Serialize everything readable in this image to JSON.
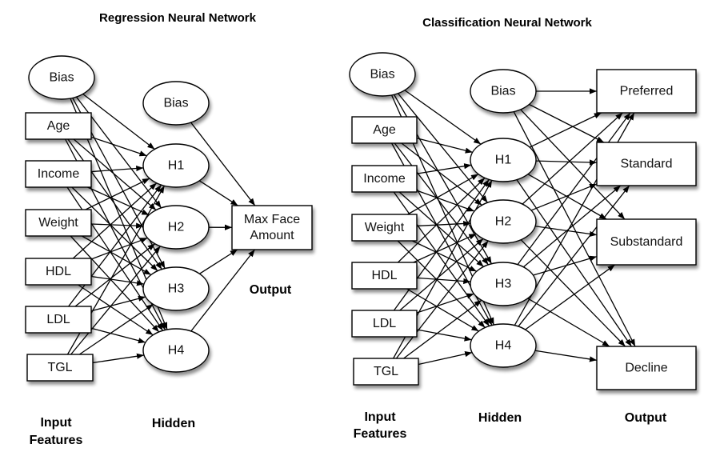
{
  "diagrams": [
    {
      "id": "regression",
      "title": "Regression Neural Network",
      "layer_labels": {
        "input": [
          "Input",
          "Features"
        ],
        "hidden": "Hidden",
        "output": "Output"
      },
      "input_nodes": [
        {
          "id": "bias_in",
          "label": "Bias",
          "shape": "ellipse"
        },
        {
          "id": "age",
          "label": "Age",
          "shape": "rect"
        },
        {
          "id": "income",
          "label": "Income",
          "shape": "rect"
        },
        {
          "id": "weight",
          "label": "Weight",
          "shape": "rect"
        },
        {
          "id": "hdl",
          "label": "HDL",
          "shape": "rect"
        },
        {
          "id": "ldl",
          "label": "LDL",
          "shape": "rect"
        },
        {
          "id": "tgl",
          "label": "TGL",
          "shape": "rect"
        }
      ],
      "hidden_nodes": [
        {
          "id": "bias_h",
          "label": "Bias",
          "shape": "ellipse"
        },
        {
          "id": "h1",
          "label": "H1",
          "shape": "ellipse"
        },
        {
          "id": "h2",
          "label": "H2",
          "shape": "ellipse"
        },
        {
          "id": "h3",
          "label": "H3",
          "shape": "ellipse"
        },
        {
          "id": "h4",
          "label": "H4",
          "shape": "ellipse"
        }
      ],
      "output_nodes": [
        {
          "id": "max_face",
          "label": [
            "Max Face",
            "Amount"
          ],
          "shape": "rect"
        }
      ],
      "connectivity": "fully connected: every input node to H1-H4; every hidden node (incl. Bias) to every output"
    },
    {
      "id": "classification",
      "title": "Classification Neural Network",
      "layer_labels": {
        "input": [
          "Input",
          "Features"
        ],
        "hidden": "Hidden",
        "output": "Output"
      },
      "input_nodes": [
        {
          "id": "bias_in",
          "label": "Bias",
          "shape": "ellipse"
        },
        {
          "id": "age",
          "label": "Age",
          "shape": "rect"
        },
        {
          "id": "income",
          "label": "Income",
          "shape": "rect"
        },
        {
          "id": "weight",
          "label": "Weight",
          "shape": "rect"
        },
        {
          "id": "hdl",
          "label": "HDL",
          "shape": "rect"
        },
        {
          "id": "ldl",
          "label": "LDL",
          "shape": "rect"
        },
        {
          "id": "tgl",
          "label": "TGL",
          "shape": "rect"
        }
      ],
      "hidden_nodes": [
        {
          "id": "bias_h",
          "label": "Bias",
          "shape": "ellipse"
        },
        {
          "id": "h1",
          "label": "H1",
          "shape": "ellipse"
        },
        {
          "id": "h2",
          "label": "H2",
          "shape": "ellipse"
        },
        {
          "id": "h3",
          "label": "H3",
          "shape": "ellipse"
        },
        {
          "id": "h4",
          "label": "H4",
          "shape": "ellipse"
        }
      ],
      "output_nodes": [
        {
          "id": "preferred",
          "label": [
            "Preferred"
          ],
          "shape": "rect"
        },
        {
          "id": "standard",
          "label": [
            "Standard"
          ],
          "shape": "rect"
        },
        {
          "id": "substandard",
          "label": [
            "Substandard"
          ],
          "shape": "rect"
        },
        {
          "id": "decline",
          "label": [
            "Decline"
          ],
          "shape": "rect"
        }
      ],
      "connectivity": "fully connected: every input node to H1-H4; every hidden node (incl. Bias) to every output"
    }
  ]
}
